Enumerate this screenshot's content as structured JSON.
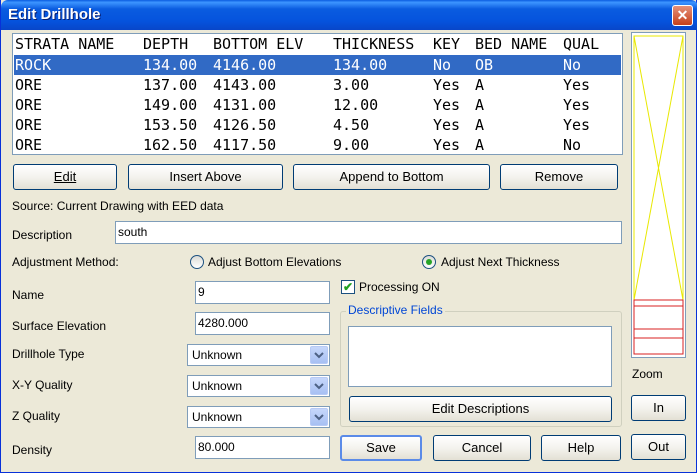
{
  "window": {
    "title": "Edit Drillhole",
    "close_glyph": "✕"
  },
  "table": {
    "columns": [
      "STRATA NAME",
      "DEPTH",
      "BOTTOM ELV",
      "THICKNESS",
      "KEY",
      "BED NAME",
      "QUAL"
    ],
    "rows": [
      [
        "ROCK",
        "134.00",
        "4146.00",
        "134.00",
        "No",
        "OB",
        "No"
      ],
      [
        "ORE",
        "137.00",
        "4143.00",
        "3.00",
        "Yes",
        "A",
        "Yes"
      ],
      [
        "ORE",
        "149.00",
        "4131.00",
        "12.00",
        "Yes",
        "A",
        "Yes"
      ],
      [
        "ORE",
        "153.50",
        "4126.50",
        "4.50",
        "Yes",
        "A",
        "Yes"
      ],
      [
        "ORE",
        "162.50",
        "4117.50",
        "9.00",
        "Yes",
        "A",
        "No"
      ]
    ],
    "selected_row": 0
  },
  "row_buttons": {
    "edit": "Edit",
    "insert_above": "Insert Above",
    "append_bottom": "Append to Bottom",
    "remove": "Remove"
  },
  "source_text": "Source: Current Drawing with EED data",
  "description": {
    "label": "Description",
    "value": "south"
  },
  "adjustment": {
    "label": "Adjustment Method:",
    "option_bottom": "Adjust Bottom Elevations",
    "option_next": "Adjust Next Thickness",
    "selected": "Adjust Next Thickness"
  },
  "fields": {
    "name": {
      "label": "Name",
      "value": "9"
    },
    "surface_elevation": {
      "label": "Surface Elevation",
      "value": "4280.000"
    },
    "drillhole_type": {
      "label": "Drillhole Type",
      "value": "Unknown"
    },
    "xy_quality": {
      "label": "X-Y Quality",
      "value": "Unknown"
    },
    "z_quality": {
      "label": "Z Quality",
      "value": "Unknown"
    },
    "density": {
      "label": "Density",
      "value": "80.000"
    }
  },
  "processing": {
    "label": "Processing ON",
    "checked": true,
    "mark": "✔"
  },
  "descriptive": {
    "title": "Descriptive Fields",
    "edit_button": "Edit Descriptions"
  },
  "footer": {
    "save": "Save",
    "cancel": "Cancel",
    "help": "Help"
  },
  "zoom": {
    "label": "Zoom",
    "in": "In",
    "out": "Out"
  },
  "colors": {
    "title_bar": "#0a5ce0",
    "selection": "#316ac5",
    "preview_outline": "#e8e800",
    "preview_strata": "#d92020"
  }
}
